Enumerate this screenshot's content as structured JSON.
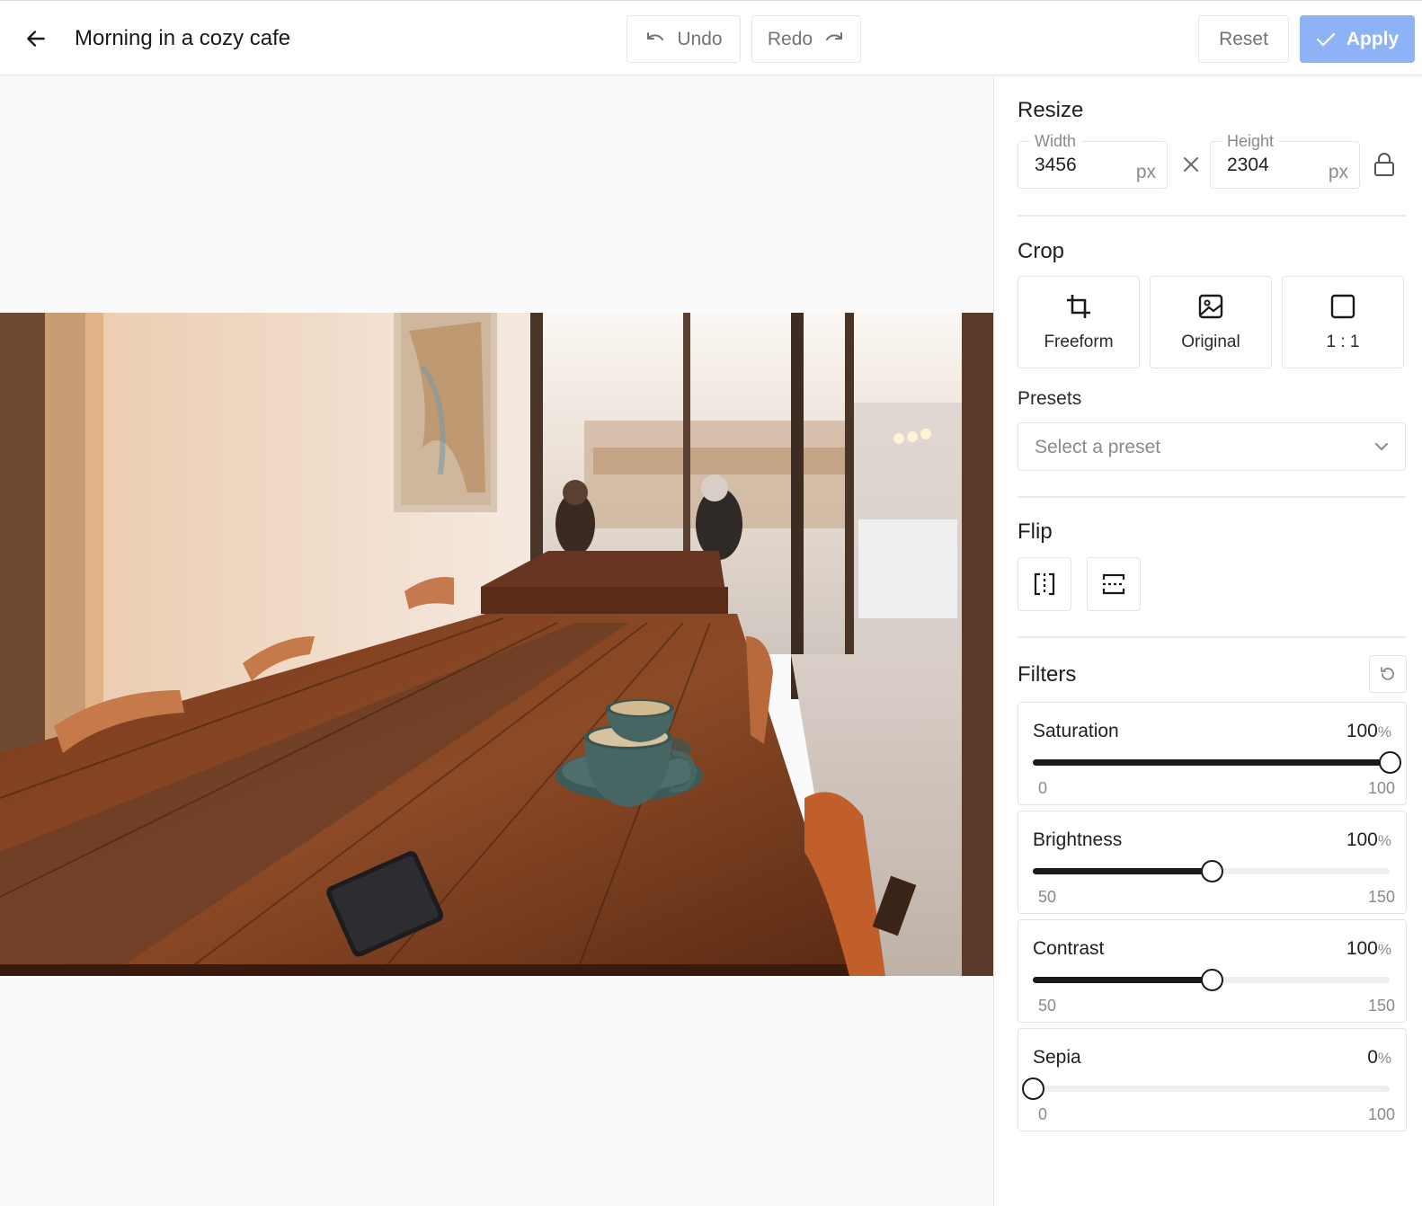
{
  "header": {
    "title": "Morning in a cozy cafe",
    "back_icon": "arrow-left-icon",
    "undo_label": "Undo",
    "redo_label": "Redo",
    "reset_label": "Reset",
    "apply_label": "Apply"
  },
  "canvas": {
    "image_subject": "cafe table with two coffee cups and a phone"
  },
  "resize": {
    "title": "Resize",
    "width_label": "Width",
    "width_value": "3456",
    "width_unit": "px",
    "height_label": "Height",
    "height_value": "2304",
    "height_unit": "px",
    "lock_icon": "lock-icon"
  },
  "crop": {
    "title": "Crop",
    "options": [
      {
        "label": "Freeform",
        "icon": "crop-icon"
      },
      {
        "label": "Original",
        "icon": "image-icon"
      },
      {
        "label": "1 : 1",
        "icon": "square-icon"
      }
    ]
  },
  "presets": {
    "title": "Presets",
    "placeholder": "Select a preset"
  },
  "flip": {
    "title": "Flip",
    "horizontal_icon": "flip-horizontal-icon",
    "vertical_icon": "flip-vertical-icon"
  },
  "filters": {
    "title": "Filters",
    "items": [
      {
        "name": "Saturation",
        "value": "100",
        "unit": "%",
        "min": "0",
        "max": "100",
        "level": 1.0
      },
      {
        "name": "Brightness",
        "value": "100",
        "unit": "%",
        "min": "50",
        "max": "150",
        "level": 0.5
      },
      {
        "name": "Contrast",
        "value": "100",
        "unit": "%",
        "min": "50",
        "max": "150",
        "level": 0.5
      },
      {
        "name": "Sepia",
        "value": "0",
        "unit": "%",
        "min": "0",
        "max": "100",
        "level": 0.0
      }
    ]
  },
  "colors": {
    "accent": "#8db2f5",
    "slider": "#1a1a1a"
  }
}
